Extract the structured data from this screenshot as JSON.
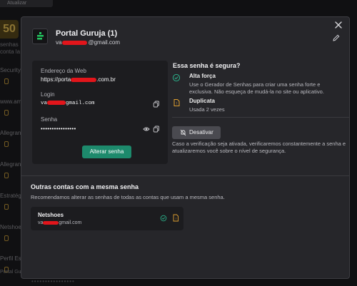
{
  "background": {
    "top_button": "Atualizar",
    "highlight_number": "50",
    "sub_lines": [
      "senhas",
      "conta la"
    ],
    "items": [
      {
        "label": "Security C"
      },
      {
        "label": "www.ames"
      },
      {
        "label": "Allegranic"
      },
      {
        "label": "Allegranic"
      },
      {
        "label": "Estratégia"
      },
      {
        "label": "Netshoes"
      },
      {
        "label": "Perfil Estra"
      },
      {
        "label": "Portal Guruja"
      }
    ],
    "footer_masked": "••••••••••••••••"
  },
  "modal": {
    "title": "Portal Guruja (1)",
    "email_prefix": "va",
    "email_suffix": "@gmail.com",
    "credentials": {
      "web_label": "Endereço da Web",
      "web_prefix": "https://porta",
      "web_suffix": ".com.br",
      "login_label": "Login",
      "login_prefix": "va",
      "login_suffix": "gmail.com",
      "password_label": "Senha",
      "password_masked": "••••••••••••••••",
      "change_button": "Alterar senha"
    },
    "security": {
      "title": "Essa senha é segura?",
      "strength_title": "Alta força",
      "strength_desc": "Use o Gerador de Senhas para criar uma senha forte e exclusiva. Não esqueça de mudá-la no site ou aplicativo.",
      "duplicate_title": "Duplicata",
      "duplicate_desc": "Usada 2 vezes",
      "deactivate_button": "Desativar",
      "verify_desc": "Caso a verificação seja ativada, verificaremos constantemente a senha e atualizaremos você sobre o nível de segurança."
    },
    "others": {
      "title": "Outras contas com a mesma senha",
      "desc": "Recomendamos alterar as senhas de todas as contas que usam a mesma senha.",
      "accounts": [
        {
          "name": "Netshoes",
          "email_prefix": "va",
          "email_suffix": "gmail.com"
        }
      ]
    }
  },
  "colors": {
    "accent_green": "#1d8a6c",
    "warning_orange": "#e0a030",
    "redaction": "#e2151b"
  },
  "icons": [
    "close-icon",
    "logo-icon",
    "edit-icon",
    "copy-icon",
    "eye-icon",
    "shield-check-icon",
    "duplicate-warning-icon",
    "bell-off-icon"
  ]
}
